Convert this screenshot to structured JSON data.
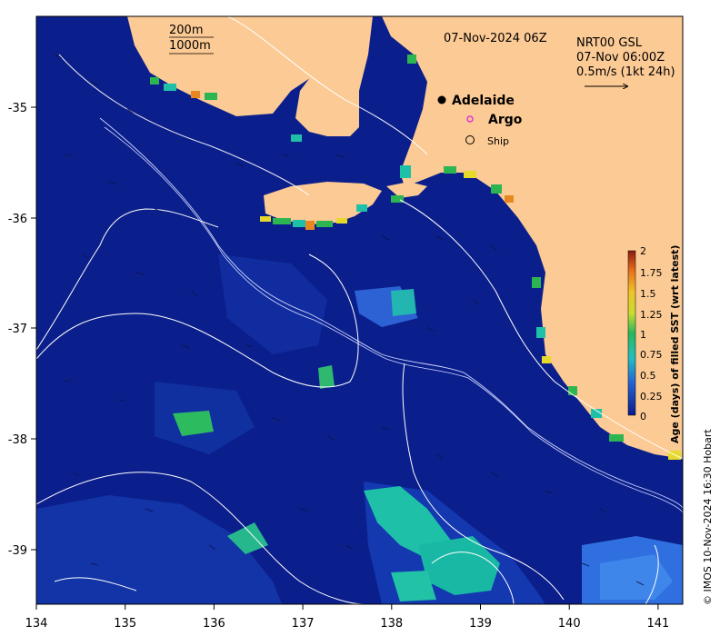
{
  "map": {
    "date_title": "07-Nov-2024 06Z",
    "legend_contours": {
      "c200": "200m",
      "c1000": "1000m"
    },
    "product": {
      "line1": "NRT00 GSL",
      "line2": "07-Nov 06:00Z",
      "line3": "0.5m/s (1kt 24h)"
    },
    "markers": {
      "city": "Adelaide",
      "argo": "Argo",
      "ship": "Ship"
    },
    "credit": "© IMOS 10-Nov-2024 16:30 Hobart",
    "lon_ticks": [
      "134",
      "135",
      "136",
      "137",
      "138",
      "139",
      "140",
      "141"
    ],
    "lat_ticks": [
      "-35",
      "-36",
      "-37",
      "-38",
      "-39"
    ],
    "colorbar": {
      "title": "Age (days) of filled SST (wrt latest)",
      "ticks": [
        "2",
        "1.75",
        "1.5",
        "1.25",
        "1",
        "0.75",
        "0.5",
        "0.25",
        "0"
      ]
    },
    "colors": {
      "land": "#fcca94",
      "ocean": "#0b1f8c",
      "ocean_light": "#1d46b8",
      "teal": "#1fc0a8",
      "green": "#2db552",
      "yellow": "#e7d92b",
      "orange": "#e8871f",
      "red": "#8b1a10"
    }
  }
}
